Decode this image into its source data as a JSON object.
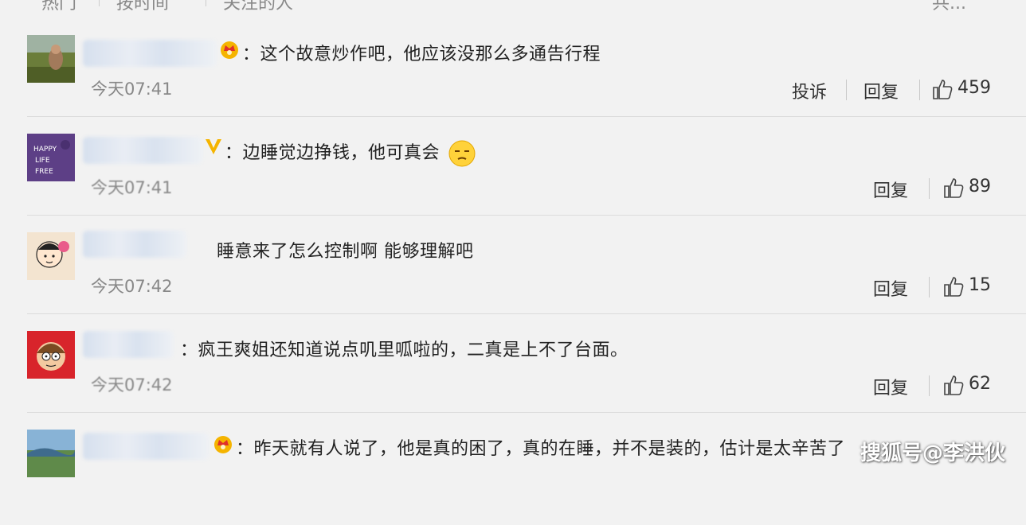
{
  "top_tabs": [
    "热门",
    "按时间",
    "关注的人"
  ],
  "top_right": "共...",
  "comments": [
    {
      "text": "：这个故意炒作吧，他应该没那么多通告行程",
      "time": "今天07:41",
      "report_label": "投诉",
      "reply_label": "回复",
      "likes": "459",
      "badge": "crown-badge"
    },
    {
      "text": "：边睡觉边挣钱，他可真会",
      "time": "今天07:41",
      "reply_label": "回复",
      "likes": "89",
      "badge": "v-badge"
    },
    {
      "text": "睡意来了怎么控制啊 能够理解吧",
      "time": "今天07:42",
      "reply_label": "回复",
      "likes": "15",
      "badge": ""
    },
    {
      "text": "：疯王爽姐还知道说点叽里呱啦的，二真是上不了台面。",
      "time": "今天07:42",
      "reply_label": "回复",
      "likes": "62",
      "badge": ""
    },
    {
      "text": "：昨天就有人说了，他是真的困了，真的在睡，并不是装的，估计是太辛苦了",
      "badge": "crown-badge"
    }
  ],
  "watermark": "搜狐号@李洪伙",
  "colors": {
    "background": "#f2f2f2",
    "text": "#222222",
    "meta": "#888888",
    "badge_gold": "#f5b400"
  }
}
